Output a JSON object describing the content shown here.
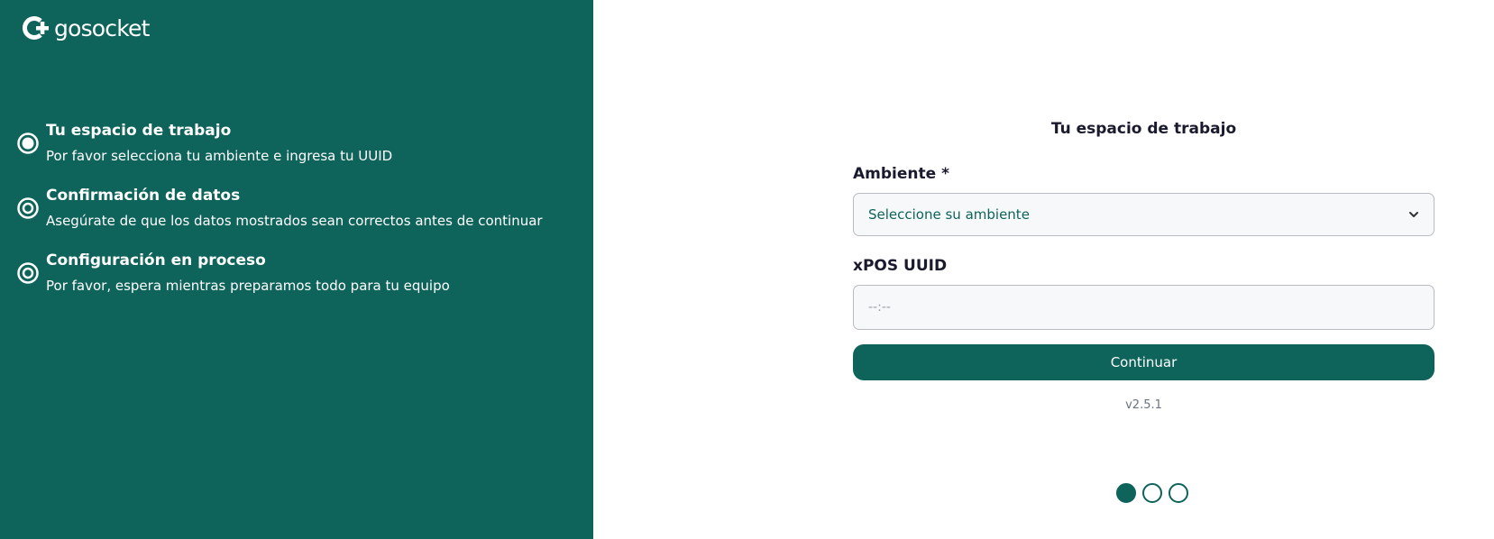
{
  "brand": {
    "name": "gosocket",
    "logo_icon": "gosocket-g-plus-icon",
    "color": "#0e635b"
  },
  "steps": [
    {
      "title": "Tu espacio de trabajo",
      "description": "Por favor selecciona tu ambiente e ingresa tu UUID",
      "state": "active",
      "icon": "radio-active-icon"
    },
    {
      "title": "Confirmación de datos",
      "description": "Asegúrate de que los datos mostrados sean correctos antes de continuar",
      "state": "pending",
      "icon": "radio-pending-icon"
    },
    {
      "title": "Configuración en proceso",
      "description": "Por favor, espera mientras preparamos todo para tu equipo",
      "state": "pending",
      "icon": "radio-pending-icon"
    }
  ],
  "form": {
    "title": "Tu espacio de trabajo",
    "ambiente": {
      "label": "Ambiente *",
      "selected": "Seleccione su ambiente",
      "icon": "chevron-down-icon"
    },
    "uuid": {
      "label": "xPOS UUID",
      "placeholder": "--:--",
      "value": ""
    },
    "submit_label": "Continuar",
    "version": "v2.5.1"
  },
  "pagination": {
    "total": 3,
    "current": 1
  }
}
